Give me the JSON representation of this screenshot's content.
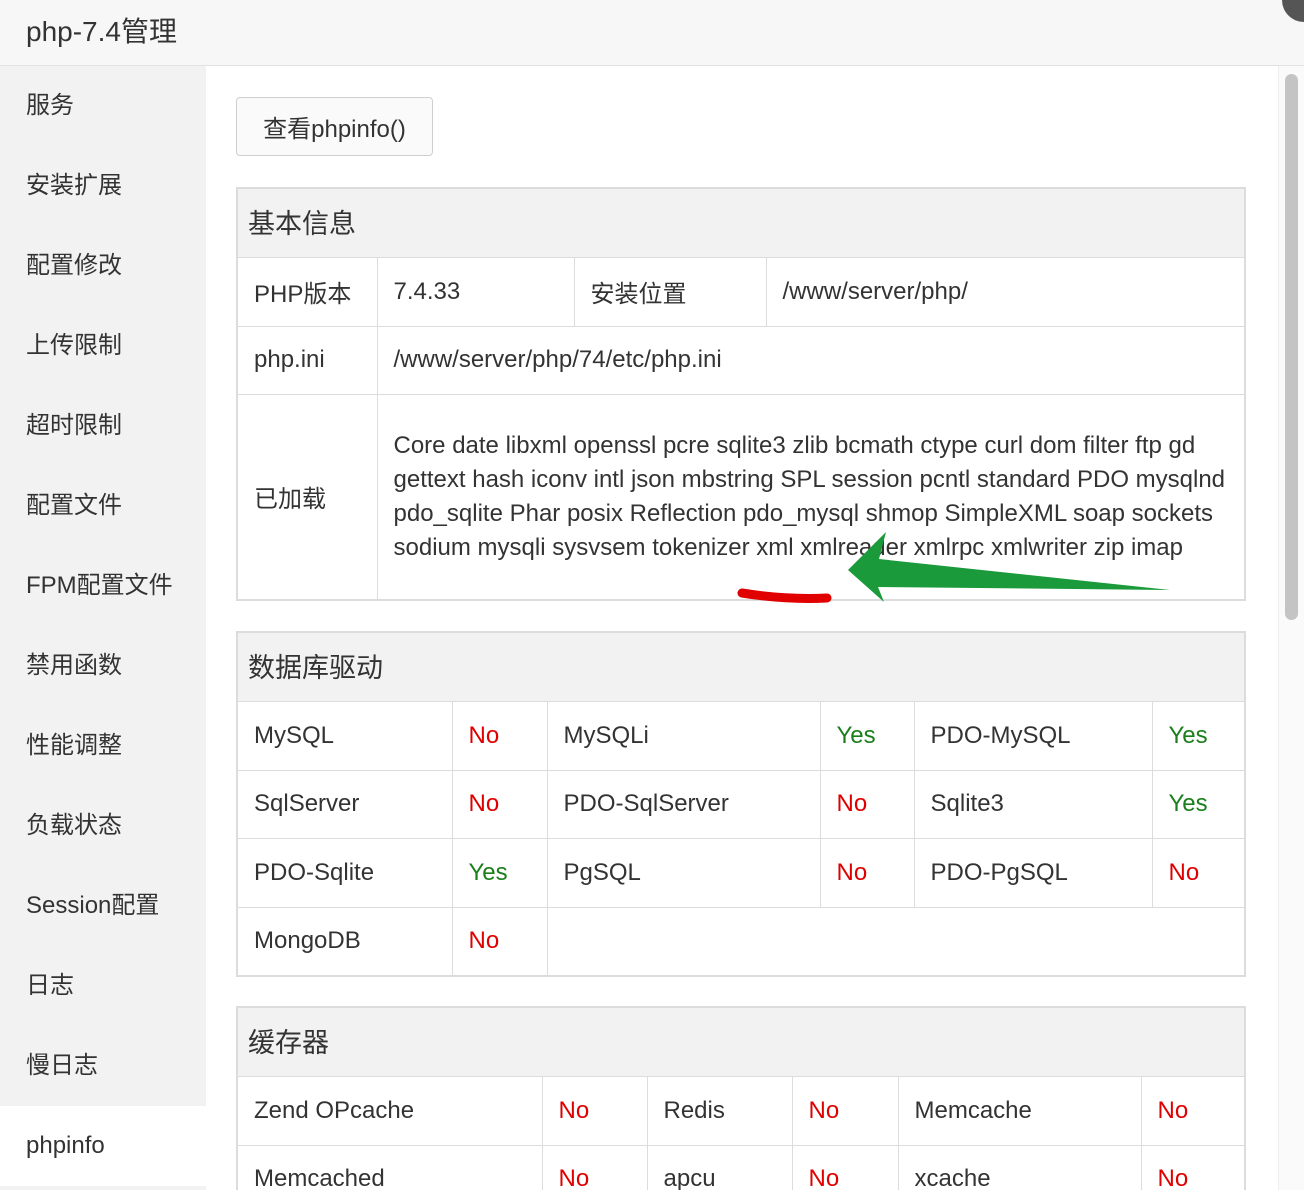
{
  "window": {
    "title": "php-7.4管理"
  },
  "sidebar": {
    "items": [
      {
        "label": "服务"
      },
      {
        "label": "安装扩展"
      },
      {
        "label": "配置修改"
      },
      {
        "label": "上传限制"
      },
      {
        "label": "超时限制"
      },
      {
        "label": "配置文件"
      },
      {
        "label": "FPM配置文件"
      },
      {
        "label": "禁用函数"
      },
      {
        "label": "性能调整"
      },
      {
        "label": "负载状态"
      },
      {
        "label": "Session配置"
      },
      {
        "label": "日志"
      },
      {
        "label": "慢日志"
      },
      {
        "label": "phpinfo"
      }
    ],
    "active": "phpinfo"
  },
  "main": {
    "phpinfo_button": "查看phpinfo()",
    "basic": {
      "title": "基本信息",
      "php_version_label": "PHP版本",
      "php_version": "7.4.33",
      "install_path_label": "安装位置",
      "install_path": "/www/server/php/",
      "ini_label": "php.ini",
      "ini_path": "/www/server/php/74/etc/php.ini",
      "loaded_label": "已加载",
      "loaded_extensions": "Core date libxml openssl pcre sqlite3 zlib bcmath ctype curl dom filter ftp gd gettext hash iconv intl json mbstring SPL session pcntl standard PDO mysqlnd pdo_sqlite Phar posix Reflection pdo_mysql shmop SimpleXML soap sockets sodium mysqli sysvsem tokenizer xml xmlreader xmlrpc xmlwriter zip imap"
    },
    "db": {
      "title": "数据库驱动",
      "rows": [
        [
          [
            "MySQL",
            "No"
          ],
          [
            "MySQLi",
            "Yes"
          ],
          [
            "PDO-MySQL",
            "Yes"
          ]
        ],
        [
          [
            "SqlServer",
            "No"
          ],
          [
            "PDO-SqlServer",
            "No"
          ],
          [
            "Sqlite3",
            "Yes"
          ]
        ],
        [
          [
            "PDO-Sqlite",
            "Yes"
          ],
          [
            "PgSQL",
            "No"
          ],
          [
            "PDO-PgSQL",
            "No"
          ]
        ],
        [
          [
            "MongoDB",
            "No"
          ]
        ]
      ]
    },
    "cache": {
      "title": "缓存器",
      "rows": [
        [
          [
            "Zend OPcache",
            "No"
          ],
          [
            "Redis",
            "No"
          ],
          [
            "Memcache",
            "No"
          ]
        ],
        [
          [
            "Memcached",
            "No"
          ],
          [
            "apcu",
            "No"
          ],
          [
            "xcache",
            "No"
          ]
        ]
      ]
    }
  },
  "colors": {
    "no": "#e00000",
    "yes": "#1a7f1a",
    "arrow": "#1a9a3a",
    "underline": "#e00000"
  }
}
